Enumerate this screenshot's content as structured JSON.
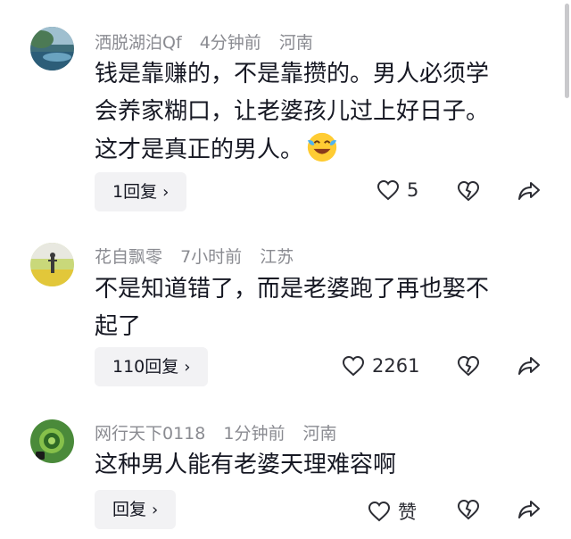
{
  "comments": [
    {
      "username": "洒脱湖泊Qf",
      "time": "4分钟前",
      "location": "河南",
      "lines": [
        "钱是靠赚的，不是靠攒的。男人必须学",
        "会养家糊口，让老婆孩儿过上好日子。",
        "这才是真正的男人。"
      ],
      "emoji": "laughing-crying-emoji",
      "reply_label": "1回复",
      "like_count": "5"
    },
    {
      "username": "花自飘零",
      "time": "7小时前",
      "location": "江苏",
      "lines": [
        "不是知道错了，而是老婆跑了再也娶不",
        "起了"
      ],
      "reply_label": "110回复",
      "like_count": "2261"
    },
    {
      "username": "网行天下0118",
      "time": "1分钟前",
      "location": "河南",
      "lines": [
        "这种男人能有老婆天理难容啊"
      ],
      "reply_label": "回复",
      "like_count": "赞"
    }
  ],
  "reply_chevron": "›",
  "icons": [
    "heart-icon",
    "dislike-icon",
    "share-icon"
  ]
}
